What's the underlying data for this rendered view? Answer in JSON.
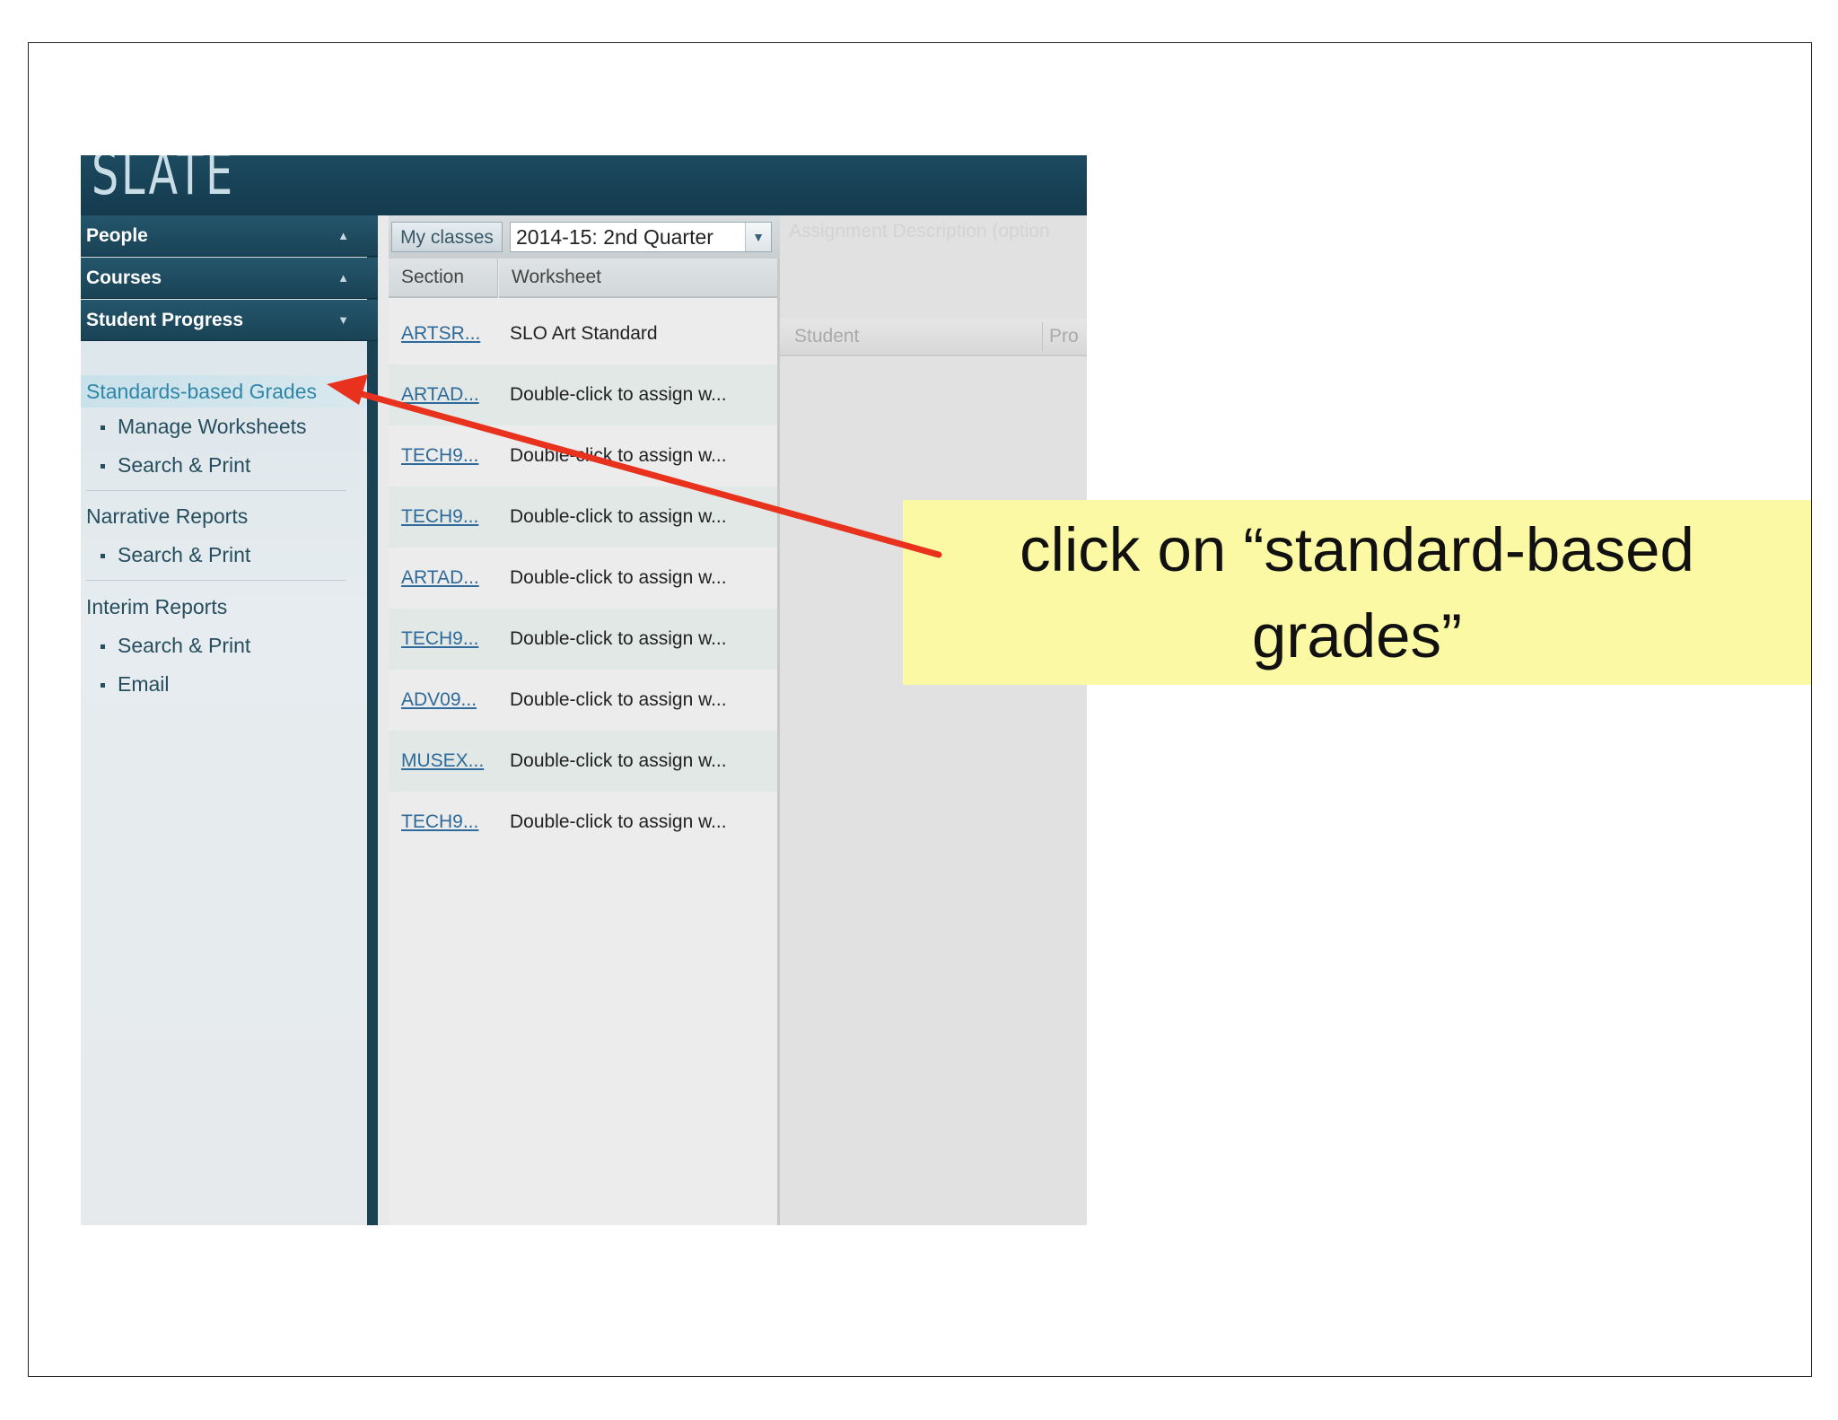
{
  "app": {
    "logo": "SLATE"
  },
  "sidebar": {
    "accordion": [
      {
        "label": "People"
      },
      {
        "label": "Courses"
      },
      {
        "label": "Student Progress"
      }
    ],
    "active_item": "Standards-based Grades",
    "sub_manage_worksheets": "Manage Worksheets",
    "sub_search_print_1": "Search & Print",
    "narrative_reports": "Narrative Reports",
    "sub_search_print_2": "Search & Print",
    "interim_reports": "Interim Reports",
    "sub_search_print_3": "Search & Print",
    "sub_email": "Email"
  },
  "toolbar": {
    "my_classes_label": "My classes",
    "term_selected": "2014-15: 2nd Quarter"
  },
  "table": {
    "col_section": "Section",
    "col_worksheet": "Worksheet",
    "rows": [
      {
        "section": "ARTSR...",
        "worksheet": "SLO Art Standard"
      },
      {
        "section": "ARTAD...",
        "worksheet": "Double-click to assign w..."
      },
      {
        "section": "TECH9...",
        "worksheet": "Double-click to assign w..."
      },
      {
        "section": "TECH9...",
        "worksheet": "Double-click to assign w..."
      },
      {
        "section": "ARTAD...",
        "worksheet": "Double-click to assign w..."
      },
      {
        "section": "TECH9...",
        "worksheet": "Double-click to assign w..."
      },
      {
        "section": "ADV09...",
        "worksheet": "Double-click to assign w..."
      },
      {
        "section": "MUSEX...",
        "worksheet": "Double-click to assign w..."
      },
      {
        "section": "TECH9...",
        "worksheet": "Double-click to assign w..."
      }
    ]
  },
  "right_panel": {
    "description_placeholder": "Assignment Description (option",
    "col_student": "Student",
    "col_partial": "Pro"
  },
  "callout": {
    "line1": "click on “standard-based",
    "line2": "grades”"
  },
  "colors": {
    "header_bg": "#1a4255",
    "accent_link": "#2e86a8",
    "callout_bg": "#fbf9a4",
    "arrow": "#e8321e"
  }
}
